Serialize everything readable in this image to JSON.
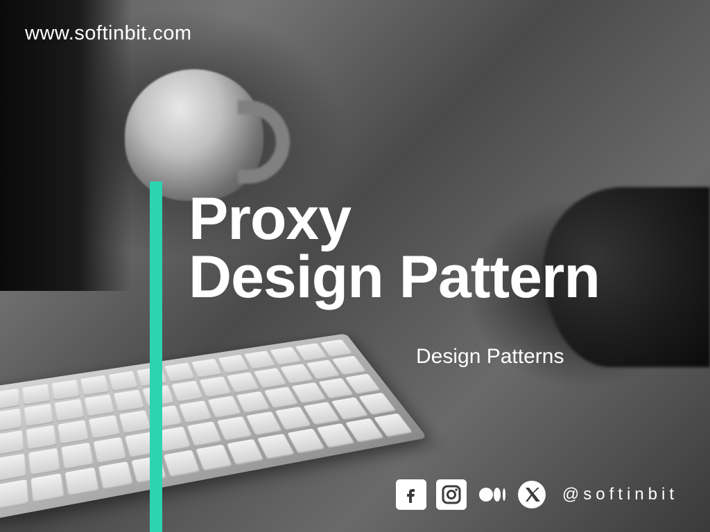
{
  "url": "www.softinbit.com",
  "title_line1": "Proxy",
  "title_line2": "Design Pattern",
  "subtitle": "Design Patterns",
  "handle": "@softinbit",
  "accent_color": "#2dd4b0",
  "social": {
    "facebook": "facebook-icon",
    "instagram": "instagram-icon",
    "medium": "medium-icon",
    "x": "x-icon"
  }
}
